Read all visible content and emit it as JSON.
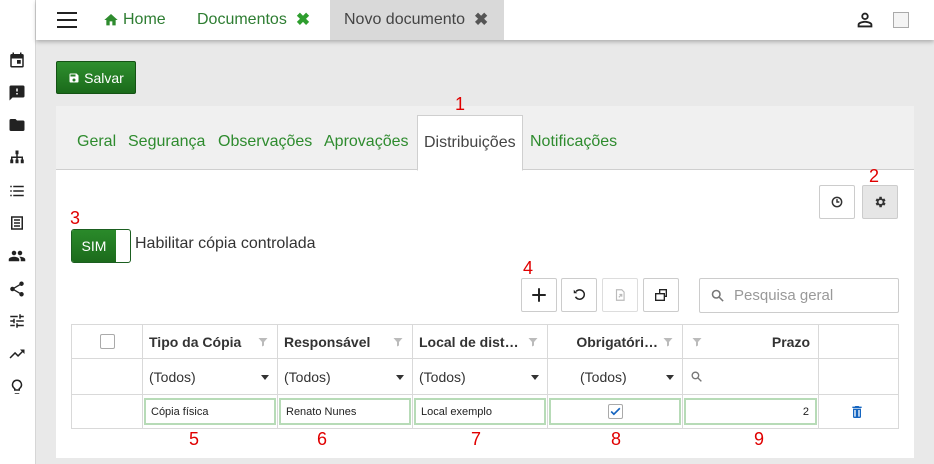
{
  "topbar": {
    "tabs": [
      {
        "label": "Home"
      },
      {
        "label": "Documentos",
        "close": "✖"
      },
      {
        "label": "Novo documento",
        "close": "✖"
      }
    ]
  },
  "toolbar": {
    "save_label": "Salvar"
  },
  "subtabs": [
    "Geral",
    "Segurança",
    "Observações",
    "Aprovações",
    "Distribuições",
    "Notificações"
  ],
  "active_subtab": "Distribuições",
  "toggle": {
    "value": "SIM",
    "label": "Habilitar cópia controlada"
  },
  "search": {
    "placeholder": "Pesquisa geral"
  },
  "grid": {
    "columns": [
      "Tipo da Cópia",
      "Responsável",
      "Local de dist…",
      "Obrigatóri…",
      "Prazo"
    ],
    "filters": [
      "(Todos)",
      "(Todos)",
      "(Todos)",
      "(Todos)"
    ],
    "row": {
      "tipo": "Cópia física",
      "responsavel": "Renato Nunes",
      "local": "Local exemplo",
      "obrigatorio": true,
      "prazo": "2"
    }
  },
  "markers": [
    "1",
    "2",
    "3",
    "4",
    "5",
    "6",
    "7",
    "8",
    "9"
  ],
  "colors": {
    "accent": "#2e8b2e",
    "marker": "#e00000",
    "delete": "#1565c0"
  }
}
